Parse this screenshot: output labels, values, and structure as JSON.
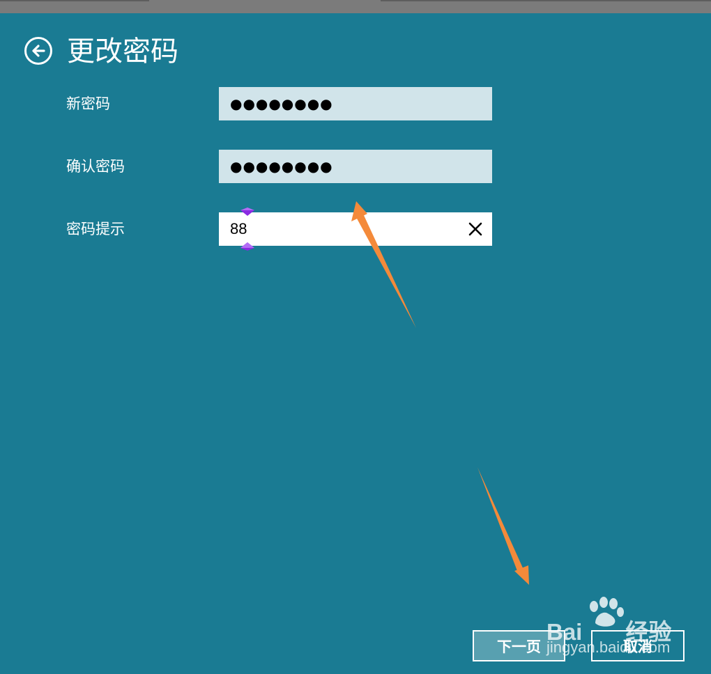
{
  "header": {
    "title": "更改密码",
    "back_icon": "arrow-left-circle-icon"
  },
  "form": {
    "new_password": {
      "label": "新密码",
      "value": "●●●●●●●●"
    },
    "confirm_password": {
      "label": "确认密码",
      "value": "●●●●●●●●"
    },
    "password_hint": {
      "label": "密码提示",
      "value": "88",
      "clear_icon": "close-icon"
    }
  },
  "buttons": {
    "next_label": "下一页",
    "cancel_label": "取消"
  },
  "watermark": {
    "brand": "Bai",
    "brand_cn": "经验",
    "url": "jingyan.baidu.com"
  },
  "colors": {
    "background": "#1a7b93",
    "password_field": "#d1e4ea",
    "next_button": "#58a0b0",
    "selection_handle": "#8b2be2",
    "annotation_arrow": "#f48a3a"
  }
}
